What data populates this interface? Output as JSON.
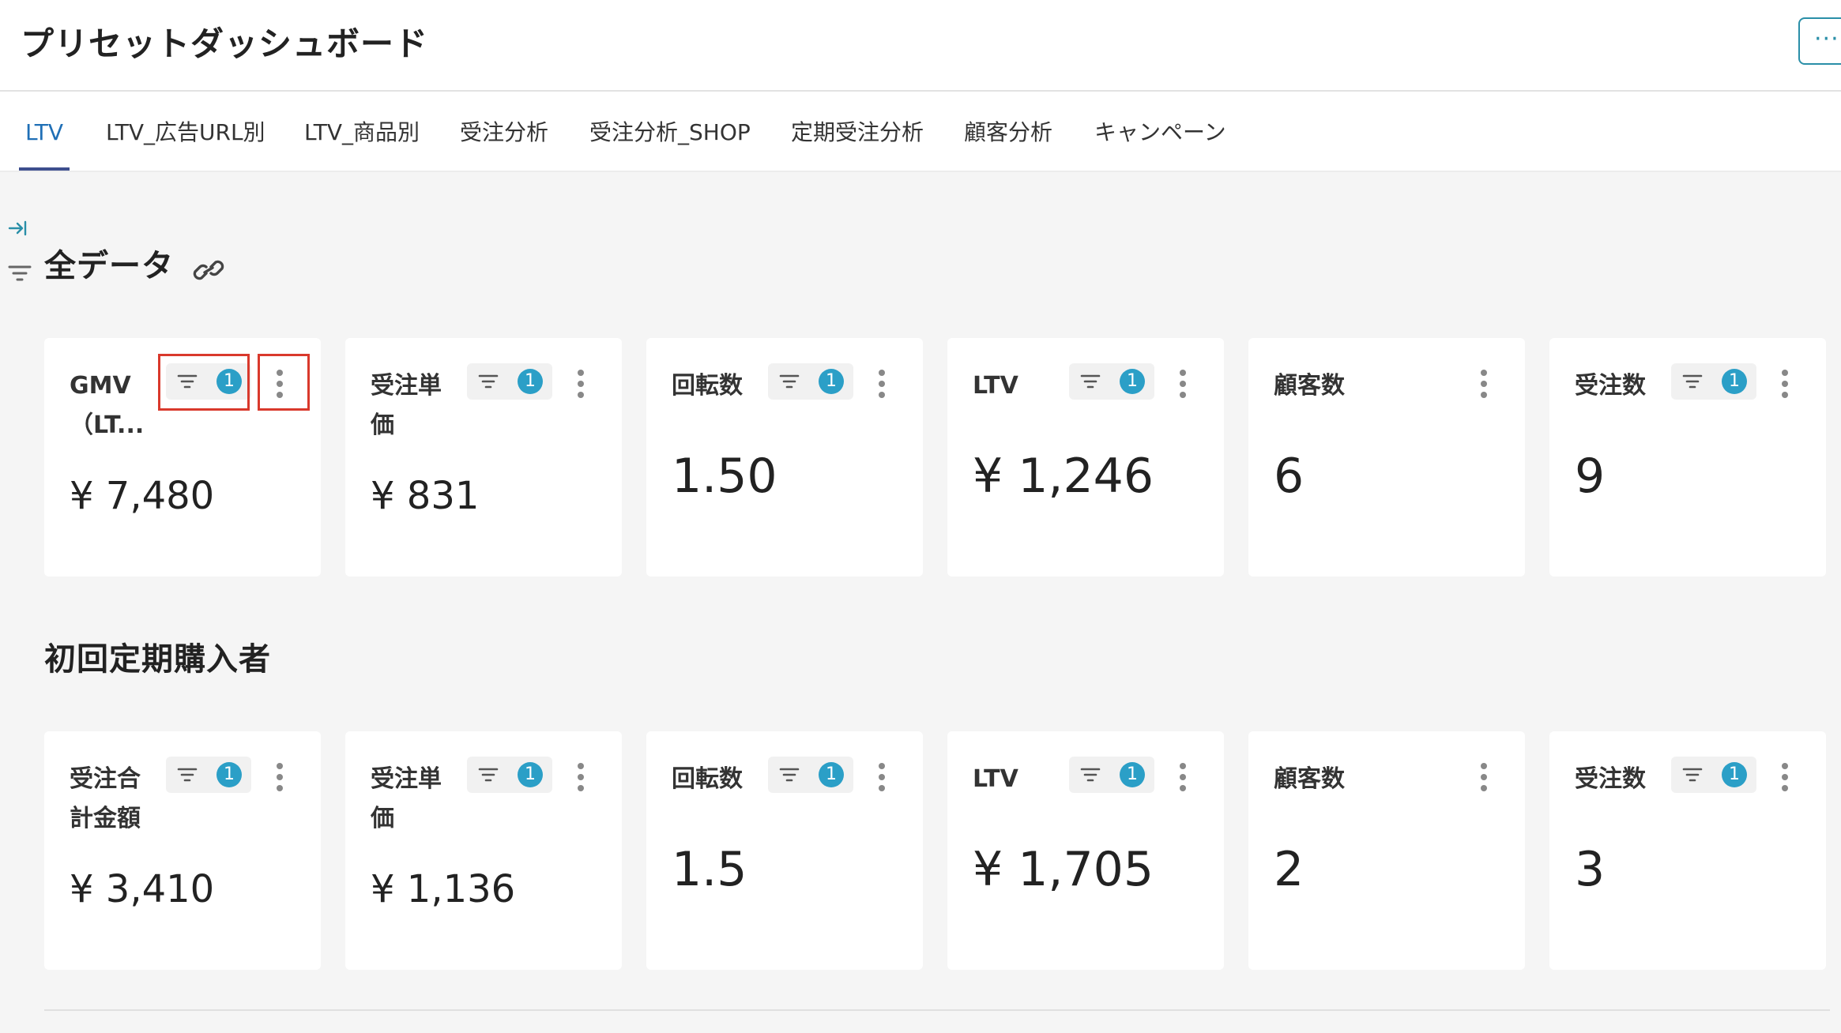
{
  "header": {
    "title": "プリセットダッシュボード",
    "more_label": "···"
  },
  "tabs": [
    {
      "label": "LTV",
      "active": true
    },
    {
      "label": "LTV_広告URL別",
      "active": false
    },
    {
      "label": "LTV_商品別",
      "active": false
    },
    {
      "label": "受注分析",
      "active": false
    },
    {
      "label": "受注分析_SHOP",
      "active": false
    },
    {
      "label": "定期受注分析",
      "active": false
    },
    {
      "label": "顧客分析",
      "active": false
    },
    {
      "label": "キャンペーン",
      "active": false
    }
  ],
  "sidebar": {
    "icons": [
      "expand-sidebar-icon",
      "filter-icon"
    ]
  },
  "sections": [
    {
      "title": "全データ",
      "has_link_icon": true,
      "cards": [
        {
          "label": "GMV（LT...",
          "value": "¥ 7,480",
          "filter_count": "1"
        },
        {
          "label": "受注単価",
          "value": "¥ 831",
          "filter_count": "1"
        },
        {
          "label": "回転数",
          "value": "1.50",
          "filter_count": "1"
        },
        {
          "label": "LTV",
          "value": "¥ 1,246",
          "filter_count": "1"
        },
        {
          "label": "顧客数",
          "value": "6",
          "filter_count": ""
        },
        {
          "label": "受注数",
          "value": "9",
          "filter_count": "1"
        }
      ]
    },
    {
      "title": "初回定期購入者",
      "has_link_icon": false,
      "cards": [
        {
          "label": "受注合計金額",
          "value": "¥ 3,410",
          "filter_count": "1"
        },
        {
          "label": "受注単価",
          "value": "¥ 1,136",
          "filter_count": "1"
        },
        {
          "label": "回転数",
          "value": "1.5",
          "filter_count": "1"
        },
        {
          "label": "LTV",
          "value": "¥ 1,705",
          "filter_count": "1"
        },
        {
          "label": "顧客数",
          "value": "2",
          "filter_count": ""
        },
        {
          "label": "受注数",
          "value": "3",
          "filter_count": "1"
        }
      ]
    }
  ],
  "colors": {
    "accent": "#1f6fb6",
    "badge": "#2b9fc7",
    "highlight": "#d9392c",
    "background": "#f5f5f5"
  }
}
